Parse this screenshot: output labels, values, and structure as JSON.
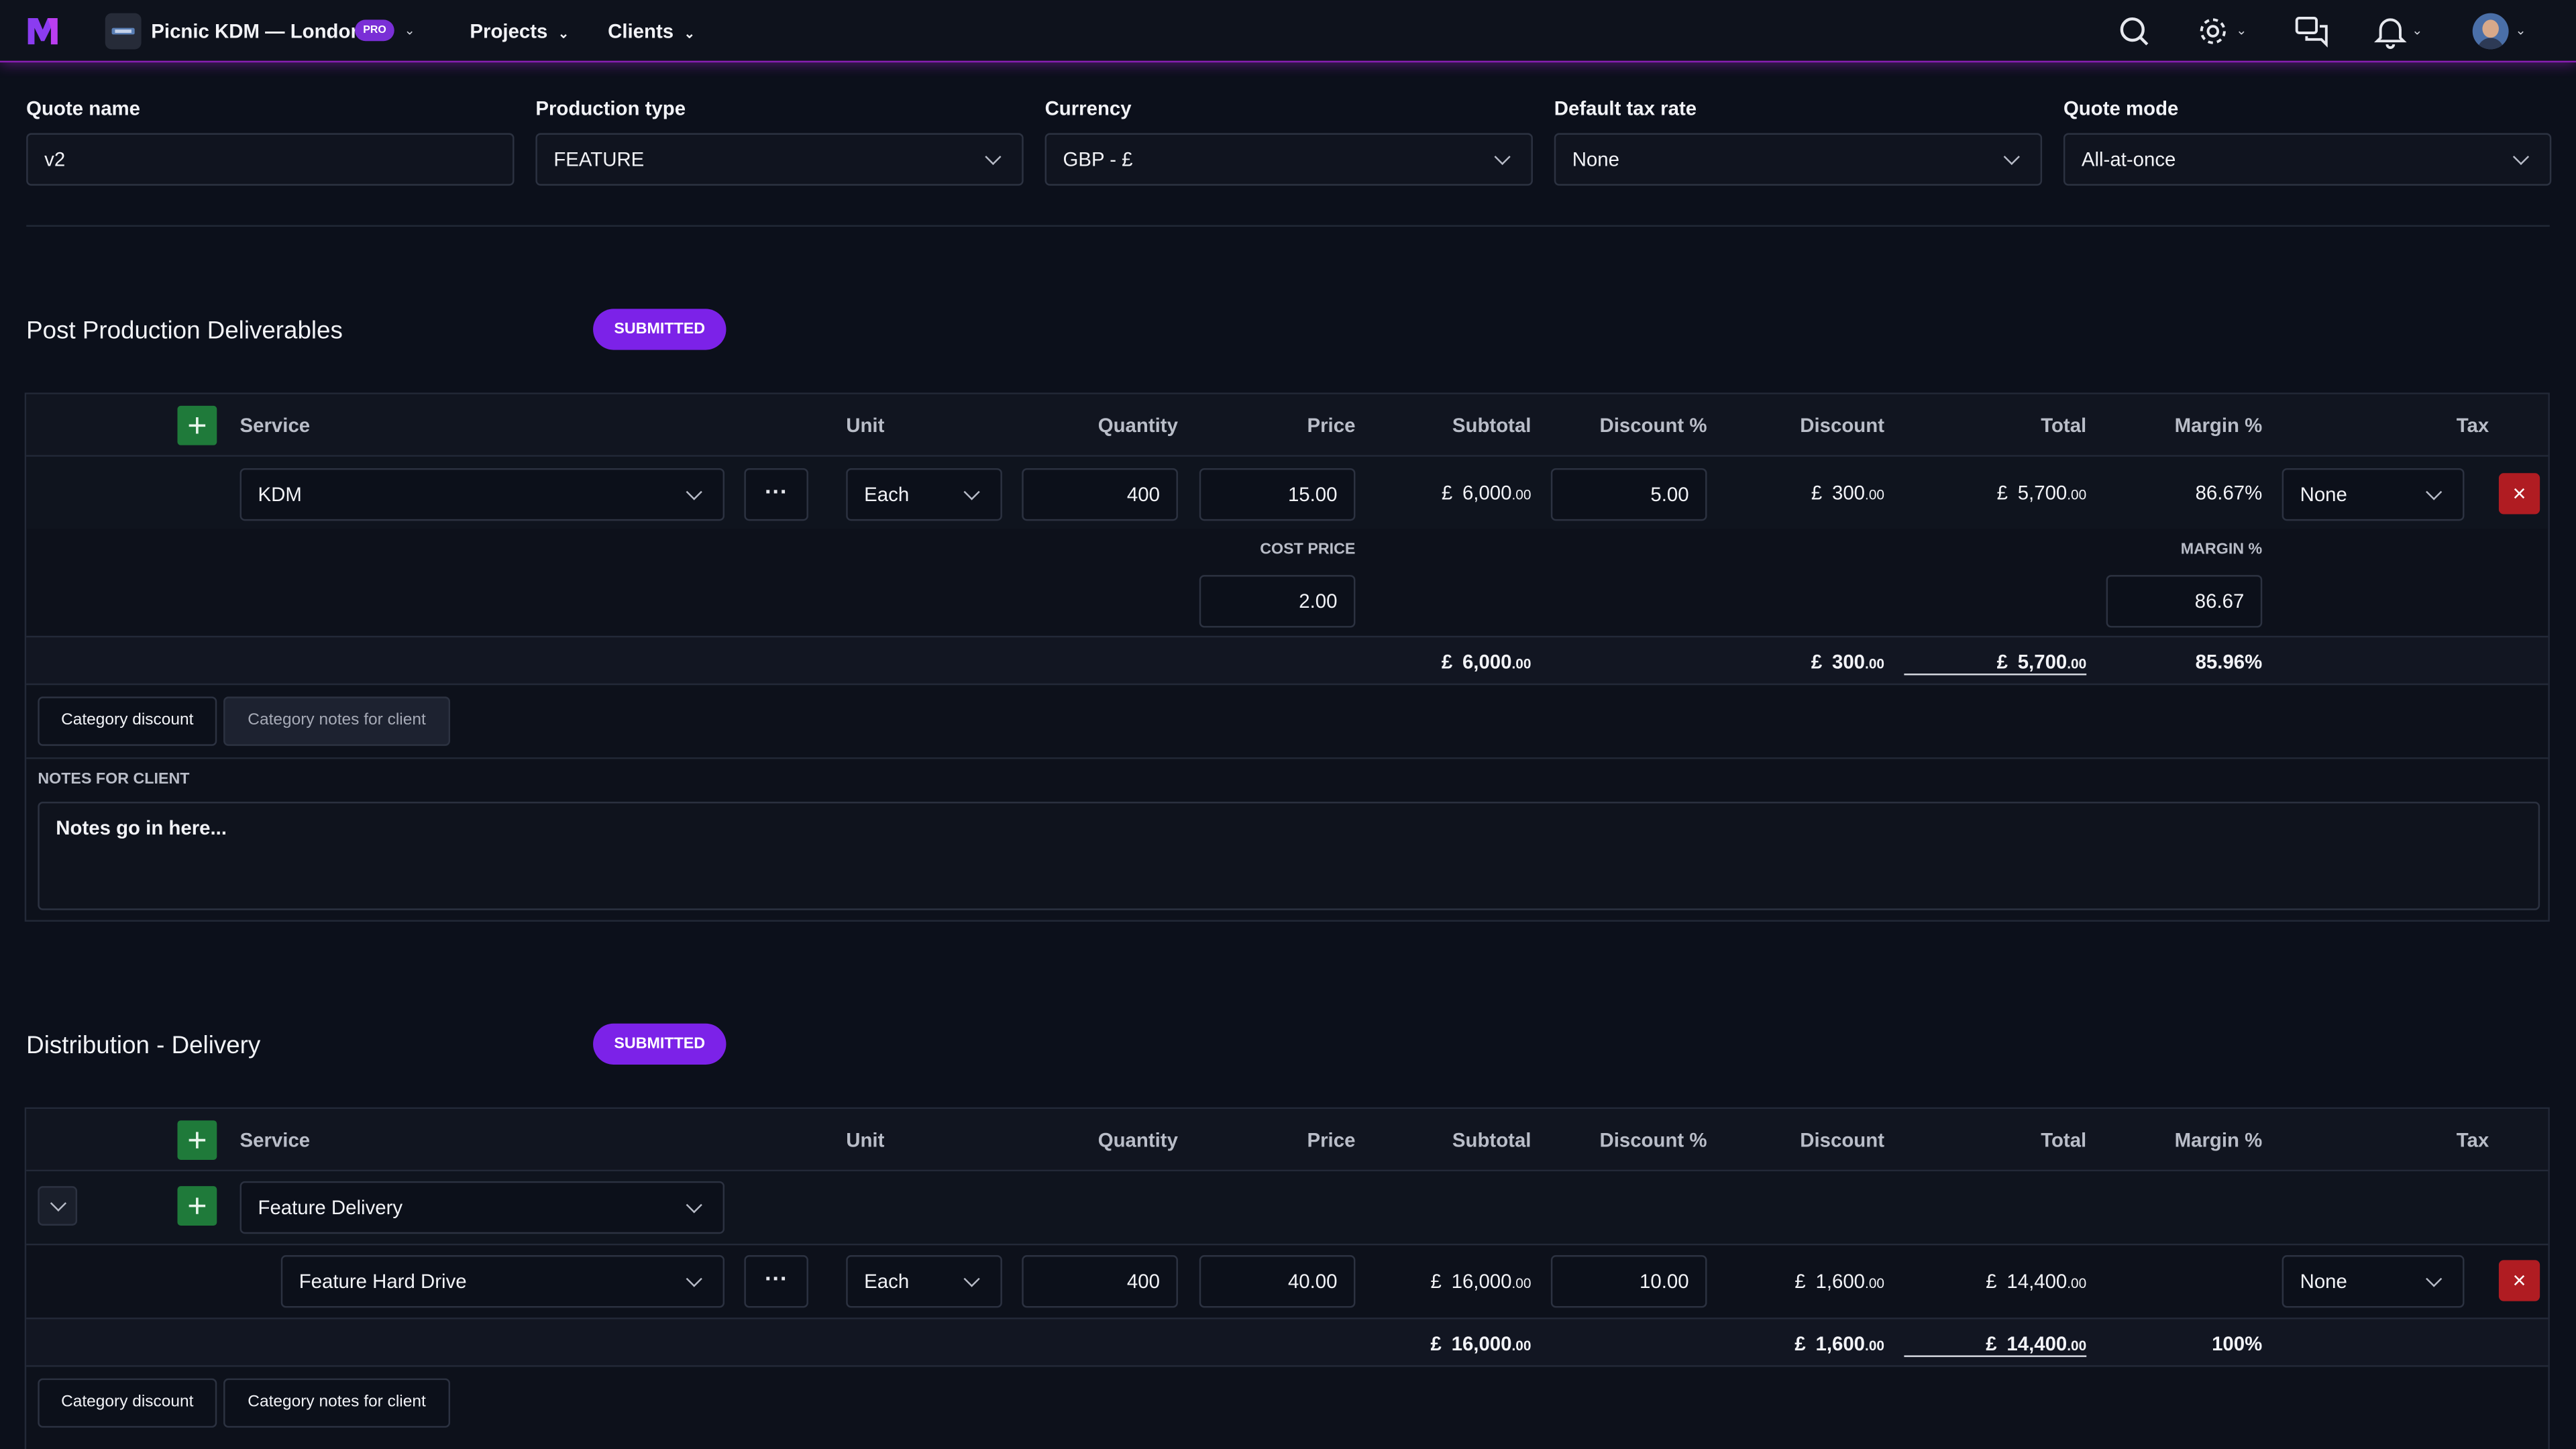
{
  "navbar": {
    "workspace_name": "Picnic KDM — London",
    "plan_badge": "PRO",
    "menu": [
      {
        "label": "Projects"
      },
      {
        "label": "Clients"
      }
    ],
    "accent_color": "#8a1fb4"
  },
  "form": {
    "quote_name": {
      "label": "Quote name",
      "value": "v2"
    },
    "production_type": {
      "label": "Production type",
      "value": "FEATURE"
    },
    "currency": {
      "label": "Currency",
      "value": "GBP - £"
    },
    "default_tax_rate": {
      "label": "Default tax rate",
      "value": "None"
    },
    "quote_mode": {
      "label": "Quote mode",
      "value": "All-at-once"
    }
  },
  "columns": {
    "service": "Service",
    "unit": "Unit",
    "quantity": "Quantity",
    "price": "Price",
    "subtotal": "Subtotal",
    "discount_pct": "Discount %",
    "discount": "Discount",
    "total": "Total",
    "margin_pct": "Margin %",
    "tax": "Tax"
  },
  "currency_symbol": "£",
  "sections": [
    {
      "title": "Post Production Deliverables",
      "status": "SUBMITTED",
      "line": {
        "service": "KDM",
        "unit": "Each",
        "quantity": "400",
        "price": "15.00",
        "subtotal_main": "6,000",
        "subtotal_dec": ".00",
        "discount_pct": "5.00",
        "discount_main": "300",
        "discount_dec": ".00",
        "total_main": "5,700",
        "total_dec": ".00",
        "margin_pct": "86.67%",
        "tax": "None",
        "cost_price_label": "COST PRICE",
        "cost_price": "2.00",
        "margin_label": "MARGIN %",
        "margin_value": "86.67"
      },
      "totals": {
        "subtotal_main": "6,000",
        "subtotal_dec": ".00",
        "discount_main": "300",
        "discount_dec": ".00",
        "total_main": "5,700",
        "total_dec": ".00",
        "margin": "85.96%"
      },
      "tabs": [
        "Category discount",
        "Category notes for client"
      ],
      "notes_label": "NOTES FOR CLIENT",
      "notes_text": "Notes go in here..."
    },
    {
      "title": "Distribution - Delivery",
      "status": "SUBMITTED",
      "group_service": "Feature Delivery",
      "line": {
        "service": "Feature Hard Drive",
        "unit": "Each",
        "quantity": "400",
        "price": "40.00",
        "subtotal_main": "16,000",
        "subtotal_dec": ".00",
        "discount_pct": "10.00",
        "discount_main": "1,600",
        "discount_dec": ".00",
        "total_main": "14,400",
        "total_dec": ".00",
        "tax": "None"
      },
      "totals": {
        "subtotal_main": "16,000",
        "subtotal_dec": ".00",
        "discount_main": "1,600",
        "discount_dec": ".00",
        "total_main": "14,400",
        "total_dec": ".00",
        "margin": "100%"
      },
      "tabs": [
        "Category discount",
        "Category notes for client"
      ]
    }
  ],
  "colors": {
    "submitted_badge": "#7c22e8",
    "add_button": "#1f7a3a",
    "delete_button": "#b01c22",
    "background": "#0c101b"
  }
}
